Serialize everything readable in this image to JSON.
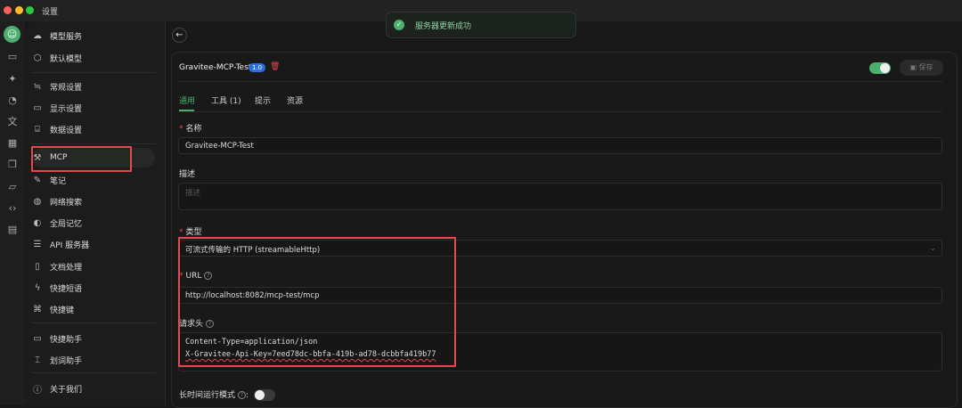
{
  "window": {
    "title": "设置"
  },
  "toast": {
    "message": "服务器更新成功"
  },
  "sidebar": {
    "items": [
      {
        "label": "模型服务",
        "icon": "cloud-icon"
      },
      {
        "label": "默认模型",
        "icon": "cube-icon"
      },
      {
        "label": "常规设置",
        "icon": "sliders-icon"
      },
      {
        "label": "显示设置",
        "icon": "monitor-icon"
      },
      {
        "label": "数据设置",
        "icon": "database-icon"
      },
      {
        "label": "MCP",
        "icon": "hammer-icon"
      },
      {
        "label": "笔记",
        "icon": "note-icon"
      },
      {
        "label": "网络搜索",
        "icon": "globe-icon"
      },
      {
        "label": "全局记忆",
        "icon": "memory-icon"
      },
      {
        "label": "API 服务器",
        "icon": "server-icon"
      },
      {
        "label": "文档处理",
        "icon": "document-icon"
      },
      {
        "label": "快捷短语",
        "icon": "zap-icon"
      },
      {
        "label": "快捷键",
        "icon": "command-icon"
      },
      {
        "label": "快捷助手",
        "icon": "window-icon"
      },
      {
        "label": "划词助手",
        "icon": "text-select-icon"
      },
      {
        "label": "关于我们",
        "icon": "info-icon"
      }
    ]
  },
  "server": {
    "name": "Gravitee-MCP-Test",
    "version": "1.0",
    "enabled": true,
    "save_label": "保存"
  },
  "tabs": [
    {
      "label": "通用"
    },
    {
      "label": "工具 (1)"
    },
    {
      "label": "提示"
    },
    {
      "label": "资源"
    }
  ],
  "form": {
    "name_label": "名称",
    "name_value": "Gravitee-MCP-Test",
    "desc_label": "描述",
    "desc_placeholder": "描述",
    "type_label": "类型",
    "type_value": "可流式传输的 HTTP (streamableHttp)",
    "url_label": "URL",
    "url_value": "http://localhost:8082/mcp-test/mcp",
    "headers_label": "请求头",
    "headers_line1": "Content-Type=application/json",
    "headers_line2": "X-Gravitee-Api-Key=7eed78dc-bbfa-419b-ad78-dcbbfa419b77",
    "long_running_label": "长时间运行模式",
    "long_running_colon": ":",
    "long_running_enabled": false
  },
  "colors": {
    "accent": "#4caf6e",
    "danger": "#e5484d",
    "badge": "#2f6fdc"
  }
}
